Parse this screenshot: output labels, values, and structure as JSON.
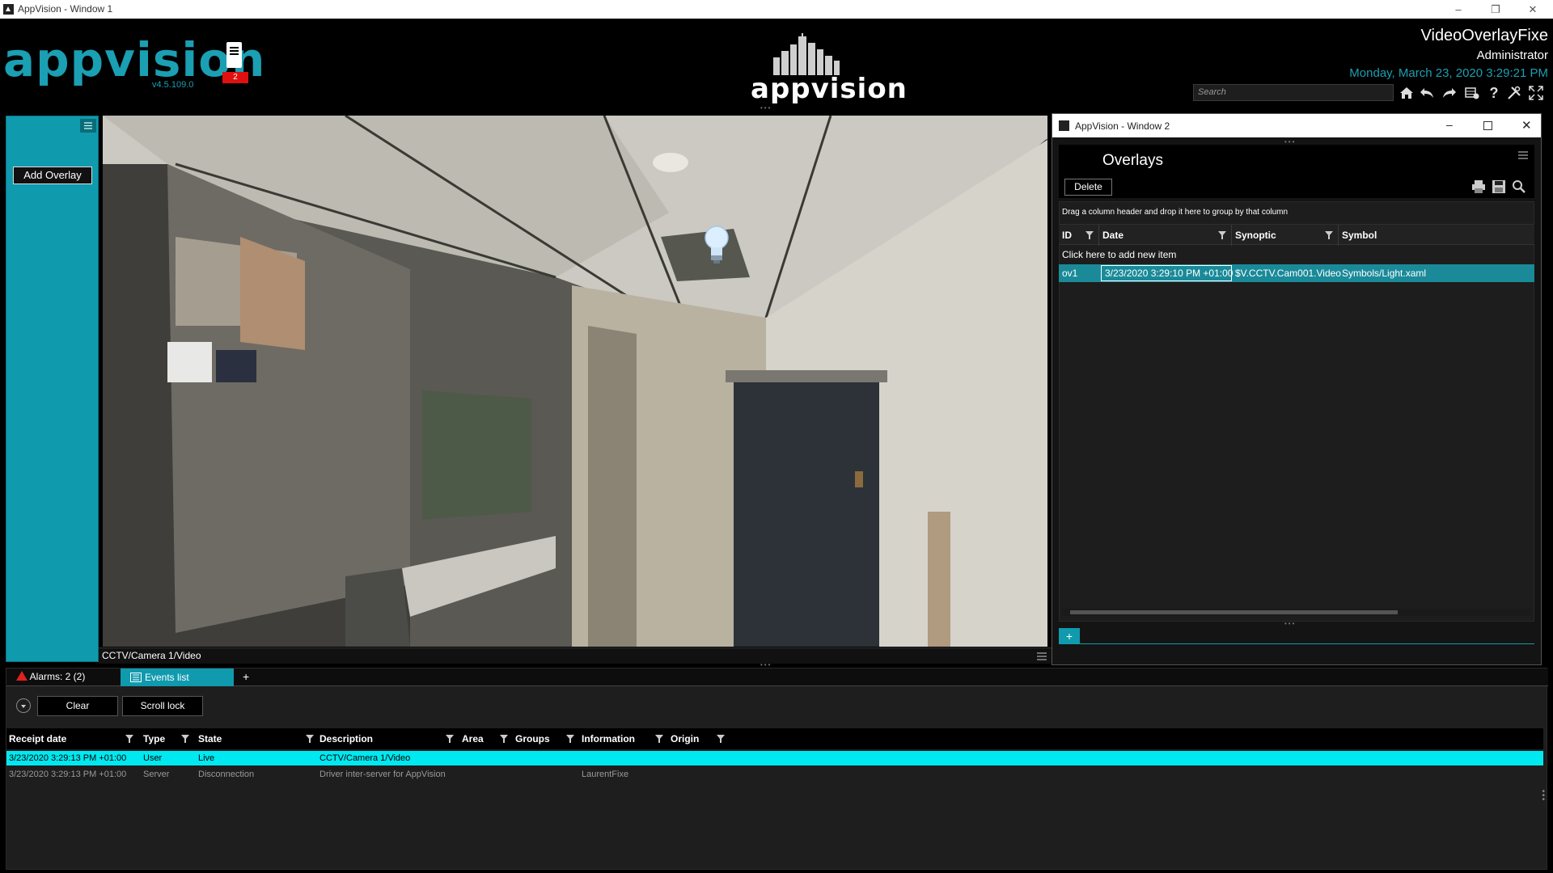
{
  "app_title": "AppVision - Window 1",
  "header": {
    "logo": "appvision",
    "version": "v4.5.109.0",
    "badge_count": "2",
    "center_logo": "appvision",
    "window_name": "VideoOverlayFixe",
    "role": "Administrator",
    "datetime": "Monday, March 23, 2020 3:29:21 PM",
    "search_placeholder": "Search"
  },
  "left_panel": {
    "add_overlay_label": "Add Overlay"
  },
  "video": {
    "caption": "CCTV/Camera 1/Video"
  },
  "window2": {
    "title": "AppVision - Window 2",
    "heading": "Overlays",
    "delete_label": "Delete",
    "group_hint": "Drag a column header and drop it here to group by that column",
    "columns": [
      "ID",
      "Date",
      "Synoptic",
      "Symbol"
    ],
    "add_new": "Click here to add new item",
    "rows": [
      {
        "id": "ov1",
        "date": "3/23/2020 3:29:10 PM +01:00",
        "synoptic": "$V.CCTV.Cam001.Video",
        "symbol": "Symbols/Light.xaml"
      }
    ],
    "add_tab": "+"
  },
  "bottom": {
    "tabs": {
      "alarms": "Alarms: 2 (2)",
      "events": "Events list",
      "add": "+"
    },
    "clear_label": "Clear",
    "scroll_lock_label": "Scroll lock",
    "columns": [
      "Receipt date",
      "Type",
      "State",
      "Description",
      "Area",
      "Groups",
      "Information",
      "Origin"
    ],
    "events": [
      {
        "date": "3/23/2020 3:29:13 PM +01:00",
        "type": "User",
        "state": "Live",
        "description": "CCTV/Camera 1/Video",
        "area": "",
        "groups": "",
        "information": "",
        "origin": ""
      },
      {
        "date": "3/23/2020 3:29:13 PM +01:00",
        "type": "Server",
        "state": "Disconnection",
        "description": "Driver inter-server for AppVision",
        "area": "",
        "groups": "",
        "information": "LaurentFixe",
        "origin": ""
      }
    ]
  },
  "colors": {
    "accent": "#109aae",
    "brand": "#1b9fb3",
    "selected_event": "#00e8f0",
    "badge": "#e01010"
  }
}
